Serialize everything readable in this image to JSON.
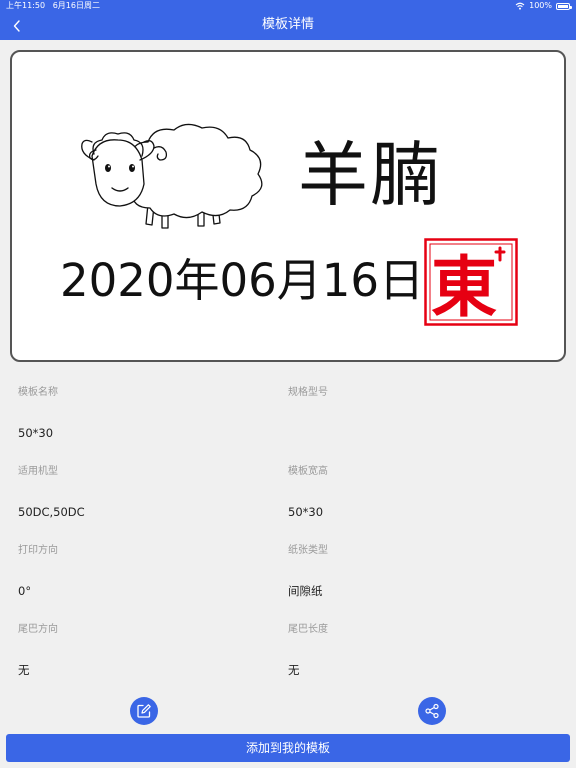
{
  "status_bar": {
    "time": "上午11:50",
    "date": "6月16日周二",
    "battery": "100%"
  },
  "nav": {
    "title": "模板详情"
  },
  "preview": {
    "name_text": "羊腩",
    "date_text": "2020年06月16日",
    "stamp_text": "東"
  },
  "fields": {
    "template_name": {
      "label": "模板名称",
      "value": "50*30"
    },
    "spec_model": {
      "label": "规格型号",
      "value": ""
    },
    "applicable_model": {
      "label": "适用机型",
      "value": "50DC,50DC"
    },
    "template_size": {
      "label": "模板宽高",
      "value": "50*30"
    },
    "print_direction": {
      "label": "打印方向",
      "value": "0°"
    },
    "paper_type": {
      "label": "纸张类型",
      "value": "间隙纸"
    },
    "tail_direction": {
      "label": "尾巴方向",
      "value": "无"
    },
    "tail_length": {
      "label": "尾巴长度",
      "value": "无"
    }
  },
  "icons": {
    "back": "chevron-left-icon",
    "edit": "edit-icon",
    "share": "share-icon",
    "wifi": "wifi-icon"
  },
  "buttons": {
    "add_label": "添加到我的模板"
  },
  "colors": {
    "accent": "#3a66e6",
    "stamp_red": "#e60012"
  }
}
